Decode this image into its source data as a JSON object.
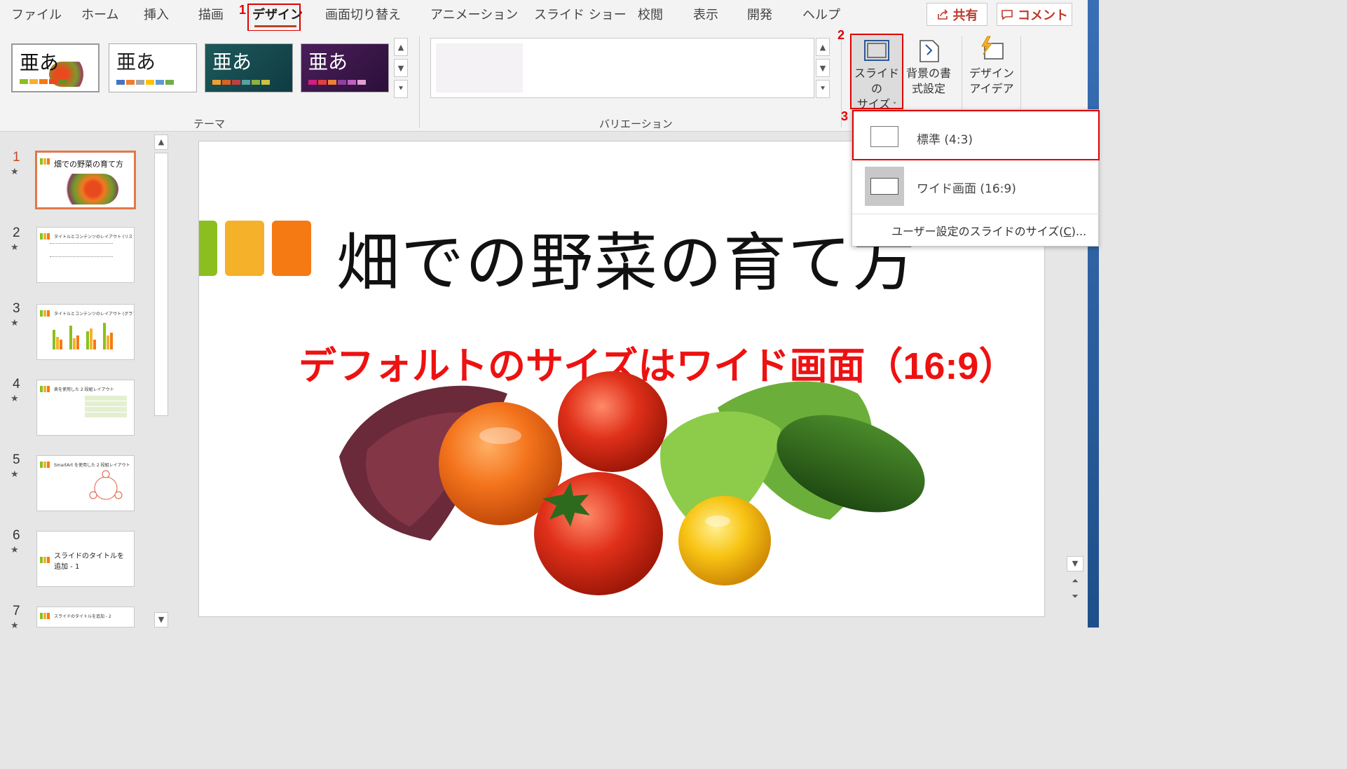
{
  "menu": {
    "tabs": [
      "ファイル",
      "ホーム",
      "挿入",
      "描画",
      "デザイン",
      "画面切り替え",
      "アニメーション",
      "スライド ショー",
      "校閲",
      "表示",
      "開発",
      "ヘルプ"
    ],
    "share_label": "共有",
    "comment_label": "コメント"
  },
  "annotations": {
    "step1": "1",
    "step2": "2",
    "step3": "3"
  },
  "ribbon": {
    "theme_sample": "亜あ",
    "themes_group": "テーマ",
    "variations_group": "バリエーション",
    "slide_size_line1": "スライドの",
    "slide_size_line2": "サイズ",
    "background_line1": "背景の書",
    "background_line2": "式設定",
    "design_idea_line1": "デザイン",
    "design_idea_line2": "アイデア"
  },
  "dropdown": {
    "standard": "標準 (4:3)",
    "widescreen": "ワイド画面 (16:9)",
    "custom_prefix": "ユーザー設定のスライドのサイズ(",
    "custom_key": "C",
    "custom_suffix": ")..."
  },
  "slides": [
    {
      "num": "1",
      "title": "畑での野菜の育て方"
    },
    {
      "num": "2",
      "title": "タイトルとコンテンツのレイアウト (リスト)"
    },
    {
      "num": "3",
      "title": "タイトルとコンテンツのレイアウト (グラフ)"
    },
    {
      "num": "4",
      "title": "表を使用した 2 段組レイアウト"
    },
    {
      "num": "5",
      "title": "SmartArt を使用した 2 段組レイアウト"
    },
    {
      "num": "6",
      "title": "スライドのタイトルを追加 - 1"
    },
    {
      "num": "7",
      "title": "スライドのタイトルを追加 - 2"
    }
  ],
  "slide_main": {
    "title": "畑での野菜の育て方",
    "annotation": "デフォルトのサイズはワイド画面（16:9）"
  },
  "colors": {
    "accent_red": "#e00000",
    "green": "#8bbf1f",
    "yellow": "#f6b12b",
    "orange": "#f57a14"
  }
}
